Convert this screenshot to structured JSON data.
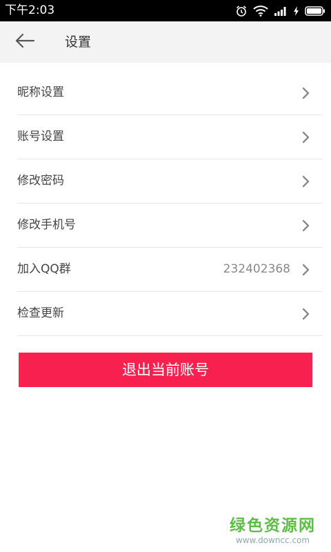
{
  "status_bar": {
    "time": "下午2:03",
    "icons": [
      "alarm-icon",
      "wifi-icon",
      "signal-icon",
      "charging-icon",
      "battery-icon"
    ]
  },
  "header": {
    "back_icon": "arrow-left-icon",
    "title": "设置"
  },
  "settings": {
    "items": [
      {
        "label": "昵称设置",
        "value": ""
      },
      {
        "label": "账号设置",
        "value": ""
      },
      {
        "label": "修改密码",
        "value": ""
      },
      {
        "label": "修改手机号",
        "value": ""
      },
      {
        "label": "加入QQ群",
        "value": "232402368"
      },
      {
        "label": "检查更新",
        "value": ""
      }
    ],
    "chevron_icon": "chevron-right-icon"
  },
  "logout": {
    "label": "退出当前账号"
  },
  "watermark": {
    "title": "绿色资源网",
    "url": "www.downcc.com"
  },
  "colors": {
    "accent": "#f8204f",
    "header_bg": "#f3f3f3",
    "divider": "#e6e6e6",
    "watermark": "#5bbf43"
  }
}
